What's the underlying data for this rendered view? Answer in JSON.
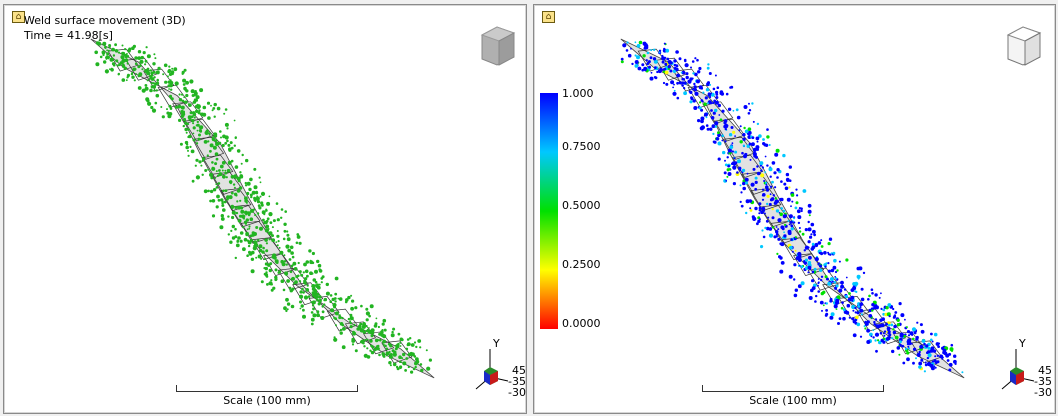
{
  "left_view": {
    "title": "Weld surface movement (3D)",
    "time": "Time = 41.98[s]",
    "scale_label": "Scale (100 mm)",
    "axis_label": "Y",
    "rotation": [
      "45",
      "-35",
      "-30"
    ],
    "cube_icon": "view-cube-icon",
    "lock_icon": "lock-icon",
    "point_color": "#22b422"
  },
  "right_view": {
    "scale_label": "Scale (100 mm)",
    "axis_label": "Y",
    "rotation": [
      "45",
      "-35",
      "-30"
    ],
    "cube_icon": "view-cube-icon",
    "lock_icon": "lock-icon",
    "legend": {
      "labels": [
        "1.000",
        "0.7500",
        "0.5000",
        "0.2500",
        "0.0000"
      ],
      "colors": [
        "#0000ff",
        "#00c8ff",
        "#00e000",
        "#ffff00",
        "#ff0000"
      ]
    }
  }
}
